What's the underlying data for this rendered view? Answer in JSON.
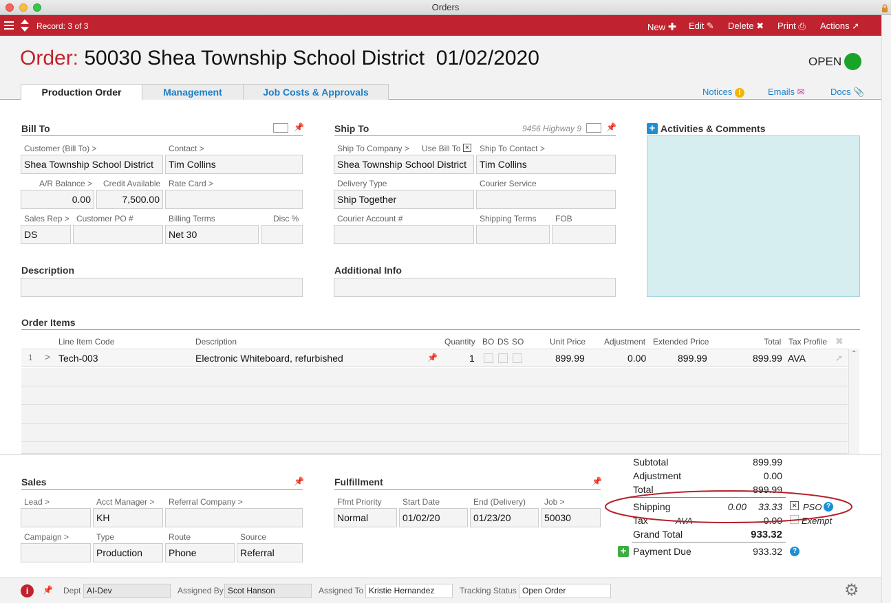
{
  "window": {
    "title": "Orders"
  },
  "toolbar": {
    "record": "Record: 3 of 3",
    "new": "New",
    "edit": "Edit",
    "delete": "Delete",
    "print": "Print",
    "actions": "Actions"
  },
  "header": {
    "order_label": "Order:",
    "order_title": "50030 Shea Township School District  01/02/2020",
    "status": "OPEN",
    "status_color": "#1aa329",
    "accent": "#c0232f",
    "tabs": [
      "Production Order",
      "Management",
      "Job Costs & Approvals"
    ],
    "links": {
      "notices": "Notices",
      "emails": "Emails",
      "docs": "Docs"
    }
  },
  "bill_to": {
    "title": "Bill To",
    "customer_label": "Customer (Bill To) >",
    "customer": "Shea Township School District",
    "contact_label": "Contact >",
    "contact": "Tim Collins",
    "ar_label": "A/R Balance >",
    "ar": "0.00",
    "credit_label": "Credit Available",
    "credit": "7,500.00",
    "rate_label": "Rate Card >",
    "rate": "",
    "salesrep_label": "Sales Rep >",
    "salesrep": "DS",
    "po_label": "Customer PO #",
    "po": "",
    "terms_label": "Billing Terms",
    "terms": "Net 30",
    "disc_label": "Disc %",
    "disc": ""
  },
  "ship_to": {
    "title": "Ship To",
    "address_hint": "9456 Highway 9",
    "company_label": "Ship To Company >",
    "use_bill_to_label": "Use Bill To",
    "company": "Shea Township School District",
    "contact_label": "Ship To Contact >",
    "contact": "Tim Collins",
    "delivery_label": "Delivery Type",
    "delivery": "Ship Together",
    "courier_label": "Courier Service",
    "courier": "",
    "courier_acct_label": "Courier Account #",
    "shipping_terms_label": "Shipping Terms",
    "fob_label": "FOB"
  },
  "activities": {
    "title": "Activities & Comments"
  },
  "description": {
    "title": "Description",
    "value": ""
  },
  "additional": {
    "title": "Additional Info",
    "value": ""
  },
  "order_items": {
    "title": "Order Items",
    "columns": {
      "code": "Line Item Code",
      "desc": "Description",
      "qty": "Quantity",
      "bo": "BO",
      "ds": "DS",
      "so": "SO",
      "unit": "Unit Price",
      "adj": "Adjustment",
      "ext": "Extended Price",
      "total": "Total",
      "tax": "Tax Profile"
    },
    "rows": [
      {
        "num": "1",
        "code": "Tech-003",
        "desc": "Electronic Whiteboard, refurbished",
        "qty": "1",
        "unit": "899.99",
        "adj": "0.00",
        "ext": "899.99",
        "total": "899.99",
        "tax": "AVA"
      }
    ]
  },
  "sales": {
    "title": "Sales",
    "lead_label": "Lead >",
    "lead": "",
    "acct_label": "Acct Manager >",
    "acct": "KH",
    "referral_label": "Referral Company >",
    "referral": "",
    "campaign_label": "Campaign >",
    "campaign": "",
    "type_label": "Type",
    "type": "Production",
    "route_label": "Route",
    "route": "Phone",
    "source_label": "Source",
    "source": "Referral"
  },
  "fulfillment": {
    "title": "Fulfillment",
    "priority_label": "Ffmt Priority",
    "priority": "Normal",
    "start_label": "Start Date",
    "start": "01/02/20",
    "end_label": "End (Delivery)",
    "end": "01/23/20",
    "job_label": "Job >",
    "job": "50030"
  },
  "totals": {
    "subtotal_label": "Subtotal",
    "subtotal": "899.99",
    "adjustment_label": "Adjustment",
    "adjustment": "0.00",
    "total_label": "Total",
    "total": "899.99",
    "shipping_label": "Shipping",
    "shipping_a": "0.00",
    "shipping_b": "33.33",
    "pso": "PSO",
    "tax_label": "Tax",
    "tax_profile": "AVA",
    "tax": "0.00",
    "exempt": "Exempt",
    "grand_label": "Grand Total",
    "grand": "933.32",
    "payment_label": "Payment Due",
    "payment": "933.32"
  },
  "footer": {
    "dept_label": "Dept",
    "dept": "AI-Dev",
    "assigned_by_label": "Assigned By",
    "assigned_by": "Scot Hanson",
    "assigned_to_label": "Assigned To",
    "assigned_to": "Kristie Hernandez",
    "tracking_label": "Tracking Status",
    "tracking": "Open Order"
  }
}
